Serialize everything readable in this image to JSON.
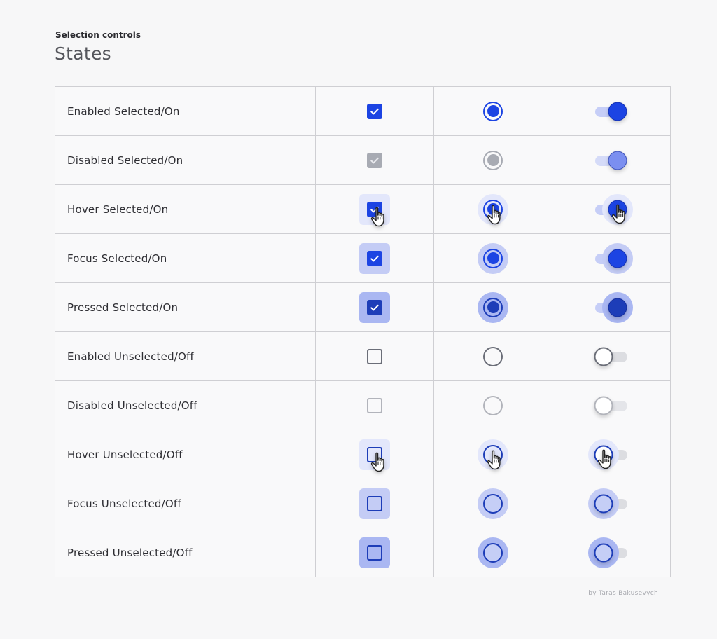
{
  "header": {
    "eyebrow": "Selection controls",
    "title": "States"
  },
  "colors": {
    "primary": "#1c44e3",
    "primary_pressed": "#1d3db8",
    "disabled_fill": "#a8abb3",
    "disabled_switch_thumb": "#7b8ff0",
    "track_on": "#c6cef7",
    "track_off": "#dcdde1",
    "outline_enabled": "#6b6e78",
    "outline_disabled": "#b2b4bb",
    "halo_hover": "#e3e7fb",
    "halo_focus": "#c4ccf5",
    "halo_pressed": "#aab7f2",
    "inner_unselected_focus": "#c5cef6"
  },
  "columns": [
    "Checkbox",
    "Radio button",
    "Switch"
  ],
  "rows": [
    {
      "label": "Enabled Selected/On",
      "selected": true,
      "state": "enabled",
      "cursor": false
    },
    {
      "label": "Disabled Selected/On",
      "selected": true,
      "state": "disabled",
      "cursor": false
    },
    {
      "label": "Hover Selected/On",
      "selected": true,
      "state": "hover",
      "cursor": true
    },
    {
      "label": "Focus Selected/On",
      "selected": true,
      "state": "focus",
      "cursor": false
    },
    {
      "label": "Pressed Selected/On",
      "selected": true,
      "state": "pressed",
      "cursor": false
    },
    {
      "label": "Enabled Unselected/Off",
      "selected": false,
      "state": "enabled",
      "cursor": false
    },
    {
      "label": "Disabled Unselected/Off",
      "selected": false,
      "state": "disabled",
      "cursor": false
    },
    {
      "label": "Hover Unselected/Off",
      "selected": false,
      "state": "hover",
      "cursor": true
    },
    {
      "label": "Focus Unselected/Off",
      "selected": false,
      "state": "focus",
      "cursor": false
    },
    {
      "label": "Pressed Unselected/Off",
      "selected": false,
      "state": "pressed",
      "cursor": false
    }
  ],
  "icons": {
    "check": "check-icon",
    "cursor": "hand-pointer-icon"
  },
  "footer": {
    "credit": "by Taras Bakusevych"
  }
}
